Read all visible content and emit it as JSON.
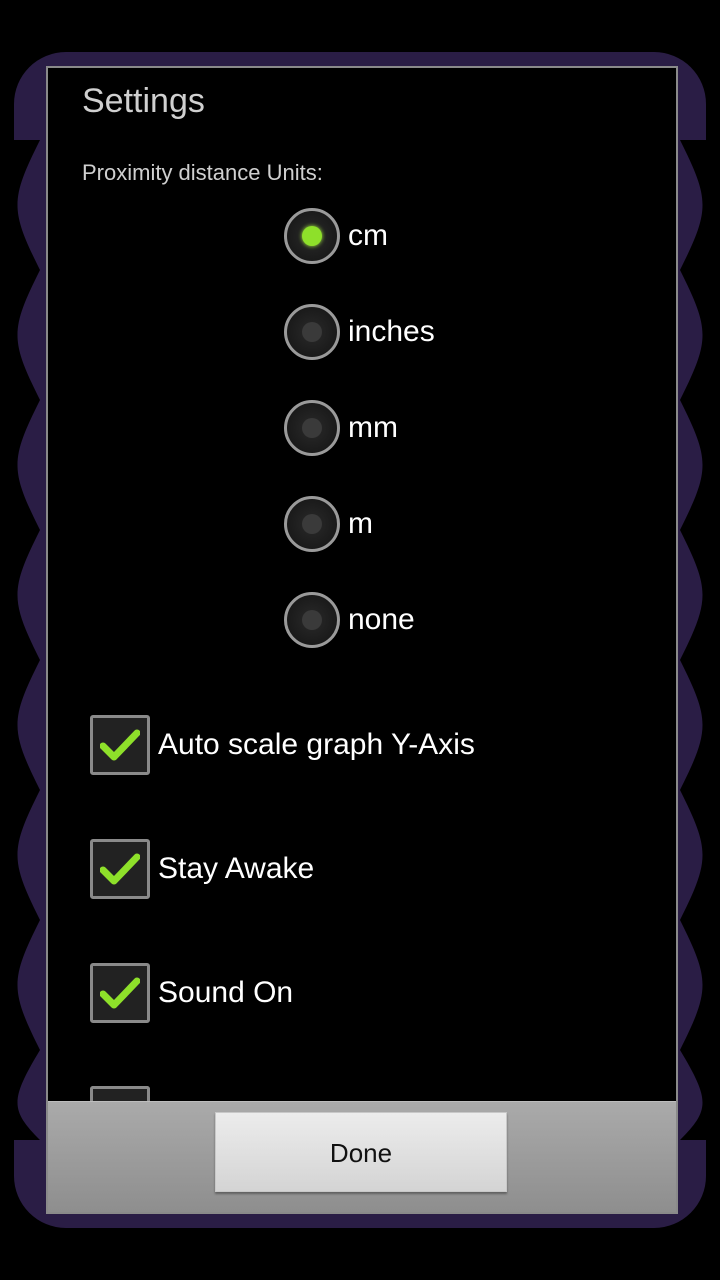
{
  "dialog": {
    "title": "Settings",
    "units_label": "Proximity distance Units:",
    "units_options": [
      {
        "label": "cm",
        "selected": true
      },
      {
        "label": "inches",
        "selected": false
      },
      {
        "label": "mm",
        "selected": false
      },
      {
        "label": "m",
        "selected": false
      },
      {
        "label": "none",
        "selected": false
      }
    ],
    "checkboxes": [
      {
        "label": "Auto scale graph Y-Axis",
        "checked": true
      },
      {
        "label": "Stay Awake",
        "checked": true
      },
      {
        "label": "Sound On",
        "checked": true
      }
    ],
    "done_label": "Done"
  },
  "colors": {
    "accent_green": "#8ee02a",
    "frame_purple": "#2a1d45"
  }
}
